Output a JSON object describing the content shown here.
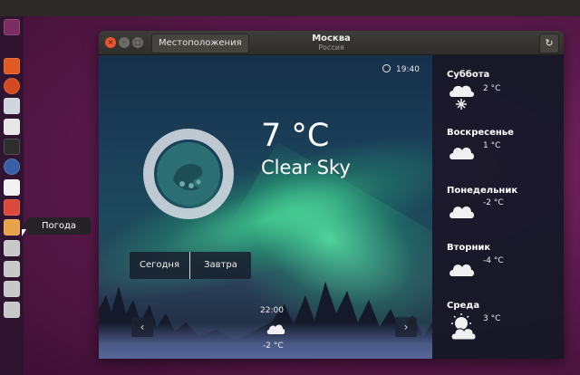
{
  "window": {
    "city": "Москва",
    "country": "Россия",
    "locations_button": "Местоположения",
    "refresh_icon": "refresh-icon"
  },
  "tooltip": "Погода",
  "current": {
    "time": "19:40",
    "temperature": "7 °C",
    "condition": "Clear Sky"
  },
  "day_tabs": {
    "today": "Сегодня",
    "tomorrow": "Завтра"
  },
  "hourly": {
    "time": "22:00",
    "temperature": "-2 °C",
    "icon": "cloud-icon"
  },
  "forecast": [
    {
      "day": "Суббота",
      "temp": "2 °C",
      "icon": "snow-icon"
    },
    {
      "day": "Воскресенье",
      "temp": "1 °C",
      "icon": "cloud-icon"
    },
    {
      "day": "Понедельник",
      "temp": "-2 °C",
      "icon": "cloud-icon"
    },
    {
      "day": "Вторник",
      "temp": "-4 °C",
      "icon": "cloud-icon"
    },
    {
      "day": "Среда",
      "temp": "3 °C",
      "icon": "sun-cloud-icon"
    }
  ],
  "colors": {
    "accent_close": "#e8552e",
    "panel": "#12182a"
  }
}
